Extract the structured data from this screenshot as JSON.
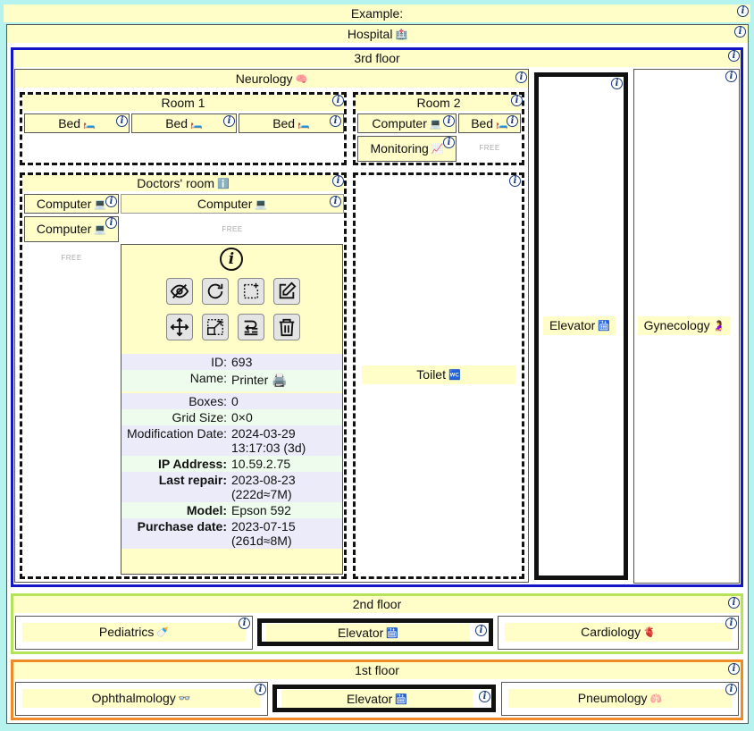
{
  "example_label": "Example:",
  "hospital": {
    "title": "Hospital",
    "title_emoji": "🏥",
    "floor3": {
      "title": "3rd floor",
      "neurology": {
        "title": "Neurology",
        "emoji": "🧠",
        "room1": {
          "title": "Room 1",
          "beds": [
            "Bed",
            "Bed",
            "Bed"
          ],
          "bed_emoji": "🛏️"
        },
        "room2": {
          "title": "Room 2",
          "computer": "Computer",
          "computer_emoji": "💻",
          "bed": "Bed",
          "bed_emoji": "🛏️",
          "monitoring": "Monitoring",
          "monitoring_emoji": "📈",
          "free": "FREE"
        },
        "doctors_room": {
          "title": "Doctors' room",
          "emoji": "ℹ️",
          "computers": [
            "Computer",
            "Computer",
            "Computer"
          ],
          "computer_emoji": "💻",
          "free_left": "FREE",
          "free_mid": "FREE"
        },
        "toilet": {
          "label": "Toilet",
          "emoji": "🚾"
        }
      },
      "elevator": {
        "label": "Elevator",
        "emoji": "🛗"
      },
      "gynecology": {
        "label": "Gynecology",
        "emoji": "🤰"
      }
    },
    "floor2": {
      "title": "2nd floor",
      "pediatrics": {
        "label": "Pediatrics",
        "emoji": "🍼"
      },
      "elevator": {
        "label": "Elevator",
        "emoji": "🛗"
      },
      "cardiology": {
        "label": "Cardiology",
        "emoji": "🫀"
      }
    },
    "floor1": {
      "title": "1st floor",
      "ophthalmology": {
        "label": "Ophthalmology",
        "emoji": "👓"
      },
      "elevator": {
        "label": "Elevator",
        "emoji": "🛗"
      },
      "pneumology": {
        "label": "Pneumology",
        "emoji": "🫁"
      }
    }
  },
  "popup": {
    "info_glyph": "i",
    "actions": [
      "hide-icon",
      "refresh-icon",
      "add-icon",
      "edit-icon",
      "move-icon",
      "resize-icon",
      "reorder-icon",
      "delete-icon"
    ],
    "fields": [
      {
        "key": "ID:",
        "value": "693",
        "bold": false
      },
      {
        "key": "Name:",
        "value": "Printer 🖨️",
        "bold": false
      },
      {
        "key": "Boxes:",
        "value": "0",
        "bold": false
      },
      {
        "key": "Grid Size:",
        "value": "0×0",
        "bold": false
      },
      {
        "key": "Modification Date:",
        "value": "2024-03-29",
        "value2": "13:17:03 (3d)",
        "bold": false
      },
      {
        "key": "IP Address:",
        "value": "10.59.2.75",
        "bold": true
      },
      {
        "key": "Last repair:",
        "value": "2023-08-23",
        "value2": "(222d≈7M)",
        "bold": true
      },
      {
        "key": "Model:",
        "value": "Epson 592",
        "bold": true
      },
      {
        "key": "Purchase date:",
        "value": "2023-07-15",
        "value2": "(261d≈8M)",
        "bold": true
      }
    ]
  },
  "colors": {
    "background": "#b6f3ee",
    "header": "#fffdc8",
    "floor3_border": "#1515c8",
    "floor2_border": "#b4e35a",
    "floor1_border": "#f08a26",
    "row_purple": "#ebebfa",
    "row_green": "#eefced"
  }
}
